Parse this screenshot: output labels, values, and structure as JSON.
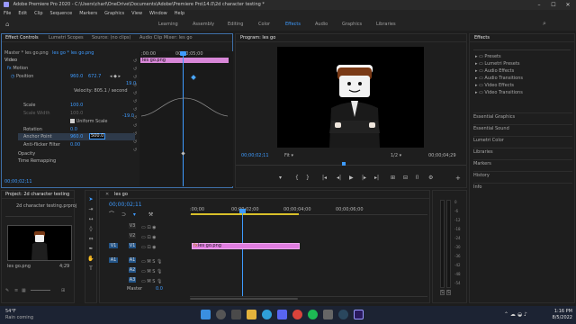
{
  "window": {
    "title": "Adobe Premiere Pro 2020 - C:\\Users\\charl\\OneDrive\\Documents\\Adobe\\Premiere Pro\\14.0\\2d character testing *"
  },
  "menu": [
    "File",
    "Edit",
    "Clip",
    "Sequence",
    "Markers",
    "Graphics",
    "View",
    "Window",
    "Help"
  ],
  "workspaces": [
    "Learning",
    "Assembly",
    "Editing",
    "Color",
    "Effects",
    "Audio",
    "Graphics",
    "Libraries"
  ],
  "active_workspace": "Effects",
  "effect_controls": {
    "tabs": [
      "Effect Controls",
      "Lumetri Scopes",
      "Source: (no clips)",
      "Audio Clip Mixer: les go"
    ],
    "clip_path": "Master * les go.png",
    "sequence_path": "les go * les go.png",
    "clip_bar_label": "les go.png",
    "ruler_start": ";00:00",
    "ruler_mid": "00;00;05;00",
    "section_video": "Video",
    "fx_motion": "Motion",
    "position_label": "Position",
    "position_x": "960.0",
    "position_y": "672.7",
    "velocity_value": "19.0",
    "velocity_text": "Velocity: 805.1 / second",
    "velocity_min": "-19.0",
    "scale_label": "Scale",
    "scale_value": "100.0",
    "scale_width_label": "Scale Width",
    "scale_width_value": "100.0",
    "uniform_scale_label": "Uniform Scale",
    "rotation_label": "Rotation",
    "rotation_value": "0.0",
    "anchor_label": "Anchor Point",
    "anchor_x": "960.0",
    "anchor_y": "500.0",
    "antiflicker_label": "Anti-flicker Filter",
    "antiflicker_value": "0.00",
    "opacity_label": "Opacity",
    "time_remap_label": "Time Remapping",
    "timecode": "00;00;02;11"
  },
  "program_monitor": {
    "title": "Program: les go",
    "timecode": "00;00;02;11",
    "fit": "Fit",
    "resolution": "1/2",
    "duration": "00;00;04;29"
  },
  "effects_panel": {
    "title": "Effects",
    "items": [
      "Presets",
      "Lumetri Presets",
      "Audio Effects",
      "Audio Transitions",
      "Video Effects",
      "Video Transitions"
    ],
    "sections": [
      "Essential Graphics",
      "Essential Sound",
      "Lumetri Color",
      "Libraries",
      "Markers",
      "History",
      "Info"
    ]
  },
  "project_panel": {
    "title": "Project: 2d character testing",
    "file": "2d character testing.prproj",
    "item_name": "les go.png",
    "item_duration": "4;29"
  },
  "timeline": {
    "title": "les go",
    "timecode": "00;00;02;11",
    "ruler_labels": [
      ":00;00",
      "00;00;02;00",
      "00;00;04;00",
      "00;00;06;00"
    ],
    "tracks_video": [
      "V3",
      "V2",
      "V1"
    ],
    "tracks_audio": [
      "A1",
      "A2",
      "A3"
    ],
    "master_label": "Master",
    "master_value": "0.0",
    "clip_label": "les go.png"
  },
  "audio_meter": {
    "labels": [
      "0",
      "-6",
      "-12",
      "-18",
      "-24",
      "-30",
      "-36",
      "-42",
      "-48",
      "-54"
    ],
    "buttons": [
      "S",
      "S"
    ]
  },
  "taskbar": {
    "weather_temp": "54°F",
    "weather_desc": "Rain coming",
    "time": "1:16 PM",
    "date": "8/5/2022",
    "app_icons": [
      "windows",
      "search",
      "task-view",
      "file-explorer",
      "edge",
      "discord",
      "chrome",
      "spotify",
      "app",
      "steam",
      "premiere"
    ]
  }
}
